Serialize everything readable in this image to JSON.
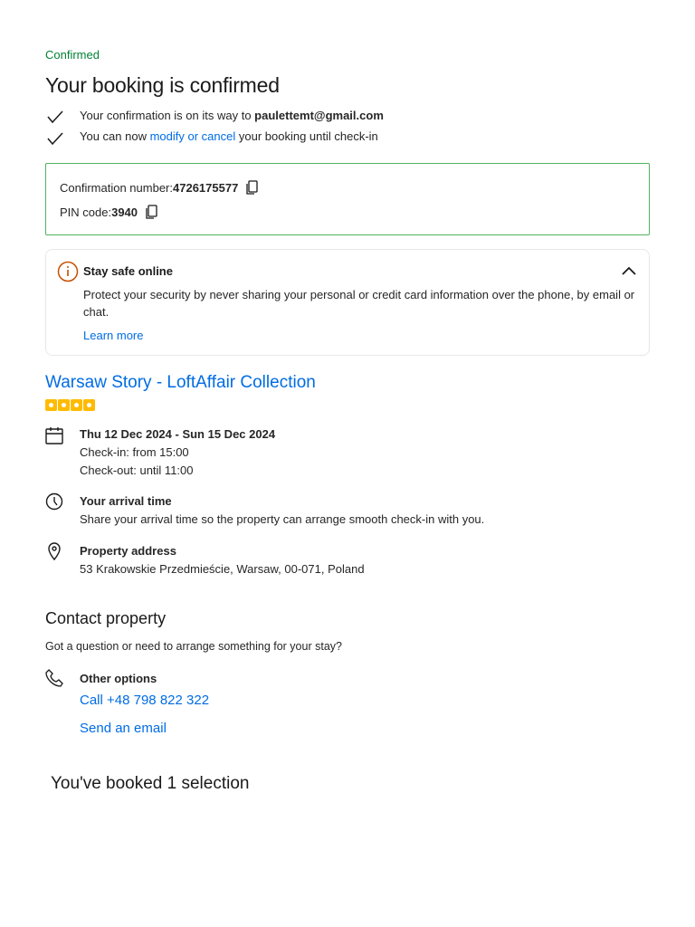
{
  "status": "Confirmed",
  "title": "Your booking is confirmed",
  "checks": {
    "line1_pre": "Your confirmation is on its way to ",
    "email": "paulettemt@gmail.com",
    "line2_pre": "You can now ",
    "modify_link": "modify or cancel",
    "line2_post": " your booking until check-in"
  },
  "confirmation": {
    "number_label": "Confirmation number: ",
    "number": "4726175577",
    "pin_label": "PIN code: ",
    "pin": "3940"
  },
  "safety": {
    "title": "Stay safe online",
    "body": "Protect your security by never sharing your personal or credit card information over the phone, by email or chat.",
    "learn_more": "Learn more"
  },
  "property": {
    "name": "Warsaw Story - LoftAffair Collection",
    "stars": 4,
    "dates": "Thu 12 Dec 2024 - Sun 15 Dec 2024",
    "checkin": "Check-in: from 15:00",
    "checkout": "Check-out: until 11:00",
    "arrival_title": "Your arrival time",
    "arrival_text": "Share your arrival time so the property can arrange smooth check-in with you.",
    "address_title": "Property address",
    "address": "53 Krakowskie Przedmieście, Warsaw, 00-071, Poland"
  },
  "contact": {
    "title": "Contact property",
    "subtitle": "Got a question or need to arrange something for your stay?",
    "options_title": "Other options",
    "call": "Call +48 798 822 322",
    "email": "Send an email"
  },
  "booked": "You've booked 1 selection"
}
